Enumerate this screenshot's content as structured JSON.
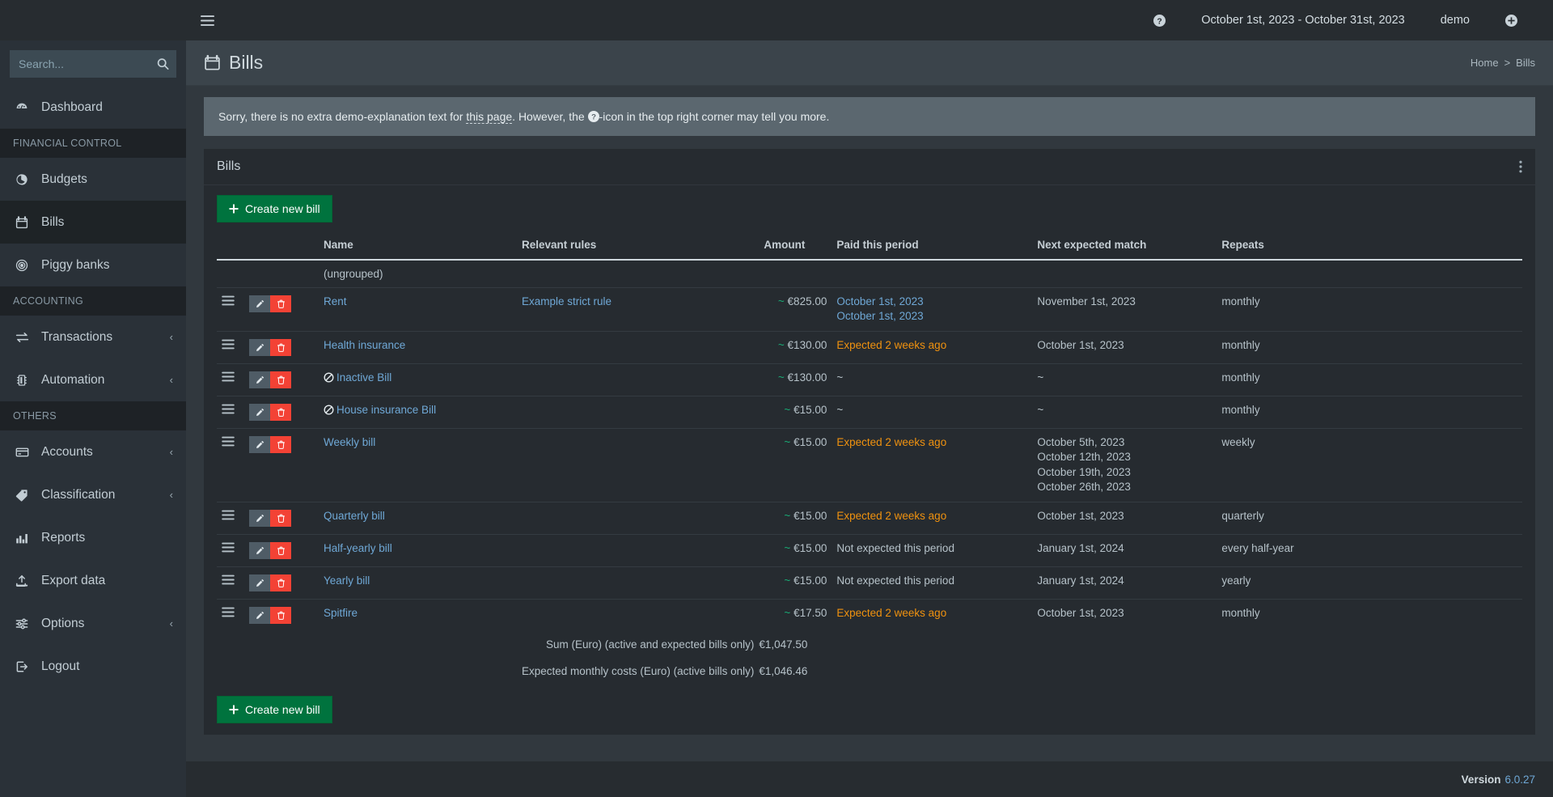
{
  "sidebar": {
    "search": {
      "placeholder": "Search...",
      "value": "",
      "icon": "search-icon"
    },
    "items": [
      {
        "type": "item",
        "label": "Dashboard",
        "icon": "dashboard-icon",
        "caret": "",
        "active": false
      },
      {
        "type": "header",
        "label": "FINANCIAL CONTROL"
      },
      {
        "type": "item",
        "label": "Budgets",
        "icon": "pie-chart-icon",
        "caret": "",
        "active": false
      },
      {
        "type": "item",
        "label": "Bills",
        "icon": "calendar-icon",
        "caret": "",
        "active": true
      },
      {
        "type": "item",
        "label": "Piggy banks",
        "icon": "piggy-bank-icon",
        "caret": "",
        "active": false
      },
      {
        "type": "header",
        "label": "ACCOUNTING"
      },
      {
        "type": "item",
        "label": "Transactions",
        "icon": "exchange-icon",
        "caret": "‹",
        "active": false
      },
      {
        "type": "item",
        "label": "Automation",
        "icon": "automation-icon",
        "caret": "‹",
        "active": false
      },
      {
        "type": "header",
        "label": "OTHERS"
      },
      {
        "type": "item",
        "label": "Accounts",
        "icon": "credit-card-icon",
        "caret": "‹",
        "active": false
      },
      {
        "type": "item",
        "label": "Classification",
        "icon": "tag-icon",
        "caret": "‹",
        "active": false
      },
      {
        "type": "item",
        "label": "Reports",
        "icon": "bar-chart-icon",
        "caret": "",
        "active": false
      },
      {
        "type": "item",
        "label": "Export data",
        "icon": "upload-icon",
        "caret": "",
        "active": false
      },
      {
        "type": "item",
        "label": "Options",
        "icon": "sliders-icon",
        "caret": "‹",
        "active": false
      },
      {
        "type": "item",
        "label": "Logout",
        "icon": "logout-icon",
        "caret": "",
        "active": false
      }
    ]
  },
  "topbar": {
    "menu_toggle": "hamburger-icon",
    "help": "question-circle-icon",
    "date_range": "October 1st, 2023 - October 31st, 2023",
    "user": "demo",
    "add": "plus-circle-icon"
  },
  "page": {
    "title": "Bills",
    "title_icon": "calendar-icon",
    "breadcrumb": {
      "home": "Home",
      "sep": ">",
      "current": "Bills"
    },
    "alert": {
      "part1": "Sorry, there is no extra demo-explanation text for ",
      "linked": "this page",
      "part2": ". However, the ",
      "icon": "question-circle-icon",
      "part3": "-icon in the top right corner may tell you more."
    }
  },
  "card": {
    "title": "Bills",
    "menu_icon": "vertical-ellipsis-icon",
    "create_button_top": "Create new bill",
    "create_button_bottom": "Create new bill",
    "plus_icon": "plus-icon"
  },
  "table": {
    "columns": [
      "",
      "",
      "Name",
      "Relevant rules",
      "Amount",
      "Paid this period",
      "Next expected match",
      "Repeats"
    ],
    "group_label": "(ungrouped)",
    "rows": [
      {
        "drag": "drag-handle-icon",
        "edit": "pencil-icon",
        "delete": "trash-icon",
        "name": "Rent",
        "inactive": false,
        "rules": "Example strict rule",
        "amount_tilde": "~",
        "amount": "€825.00",
        "paid": [
          "October 1st, 2023",
          "October 1st, 2023"
        ],
        "paid_style": "link",
        "next": [
          "November 1st, 2023"
        ],
        "repeats": "monthly"
      },
      {
        "drag": "drag-handle-icon",
        "edit": "pencil-icon",
        "delete": "trash-icon",
        "name": "Health insurance",
        "inactive": false,
        "rules": "",
        "amount_tilde": "~",
        "amount": "€130.00",
        "paid": [
          "Expected 2 weeks ago"
        ],
        "paid_style": "warn",
        "next": [
          "October 1st, 2023"
        ],
        "repeats": "monthly"
      },
      {
        "drag": "drag-handle-icon",
        "edit": "pencil-icon",
        "delete": "trash-icon",
        "name": "Inactive Bill",
        "inactive": true,
        "rules": "",
        "amount_tilde": "~",
        "amount": "€130.00",
        "paid": [
          "~"
        ],
        "paid_style": "muted",
        "next": [
          "~"
        ],
        "repeats": "monthly"
      },
      {
        "drag": "drag-handle-icon",
        "edit": "pencil-icon",
        "delete": "trash-icon",
        "name": "House insurance Bill",
        "inactive": true,
        "rules": "",
        "amount_tilde": "~",
        "amount": "€15.00",
        "paid": [
          "~"
        ],
        "paid_style": "muted",
        "next": [
          "~"
        ],
        "repeats": "monthly"
      },
      {
        "drag": "drag-handle-icon",
        "edit": "pencil-icon",
        "delete": "trash-icon",
        "name": "Weekly bill",
        "inactive": false,
        "rules": "",
        "amount_tilde": "~",
        "amount": "€15.00",
        "paid": [
          "Expected 2 weeks ago"
        ],
        "paid_style": "warn",
        "next": [
          "October 5th, 2023",
          "October 12th, 2023",
          "October 19th, 2023",
          "October 26th, 2023"
        ],
        "repeats": "weekly"
      },
      {
        "drag": "drag-handle-icon",
        "edit": "pencil-icon",
        "delete": "trash-icon",
        "name": "Quarterly bill",
        "inactive": false,
        "rules": "",
        "amount_tilde": "~",
        "amount": "€15.00",
        "paid": [
          "Expected 2 weeks ago"
        ],
        "paid_style": "warn",
        "next": [
          "October 1st, 2023"
        ],
        "repeats": "quarterly"
      },
      {
        "drag": "drag-handle-icon",
        "edit": "pencil-icon",
        "delete": "trash-icon",
        "name": "Half-yearly bill",
        "inactive": false,
        "rules": "",
        "amount_tilde": "~",
        "amount": "€15.00",
        "paid": [
          "Not expected this period"
        ],
        "paid_style": "muted",
        "next": [
          "January 1st, 2024"
        ],
        "repeats": "every half-year"
      },
      {
        "drag": "drag-handle-icon",
        "edit": "pencil-icon",
        "delete": "trash-icon",
        "name": "Yearly bill",
        "inactive": false,
        "rules": "",
        "amount_tilde": "~",
        "amount": "€15.00",
        "paid": [
          "Not expected this period"
        ],
        "paid_style": "muted",
        "next": [
          "January 1st, 2024"
        ],
        "repeats": "yearly"
      },
      {
        "drag": "drag-handle-icon",
        "edit": "pencil-icon",
        "delete": "trash-icon",
        "name": "Spitfire",
        "inactive": false,
        "rules": "",
        "amount_tilde": "~",
        "amount": "€17.50",
        "paid": [
          "Expected 2 weeks ago"
        ],
        "paid_style": "warn",
        "next": [
          "October 1st, 2023"
        ],
        "repeats": "monthly"
      }
    ],
    "summary": [
      {
        "label": "Sum (Euro) (active and expected bills only)",
        "value": "€1,047.50"
      },
      {
        "label": "Expected monthly costs (Euro) (active bills only)",
        "value": "€1,046.46"
      }
    ]
  },
  "footer": {
    "version_label": "Version",
    "version": "6.0.27"
  },
  "colors": {
    "accent_green": "#00733e",
    "link_blue": "#6fa8d6",
    "money_green": "#19a974",
    "warn_orange": "#f0920f",
    "danger_red": "#f34235",
    "sidebar_bg": "#2a3138",
    "content_bg": "#31383e",
    "card_bg": "#262b30"
  }
}
